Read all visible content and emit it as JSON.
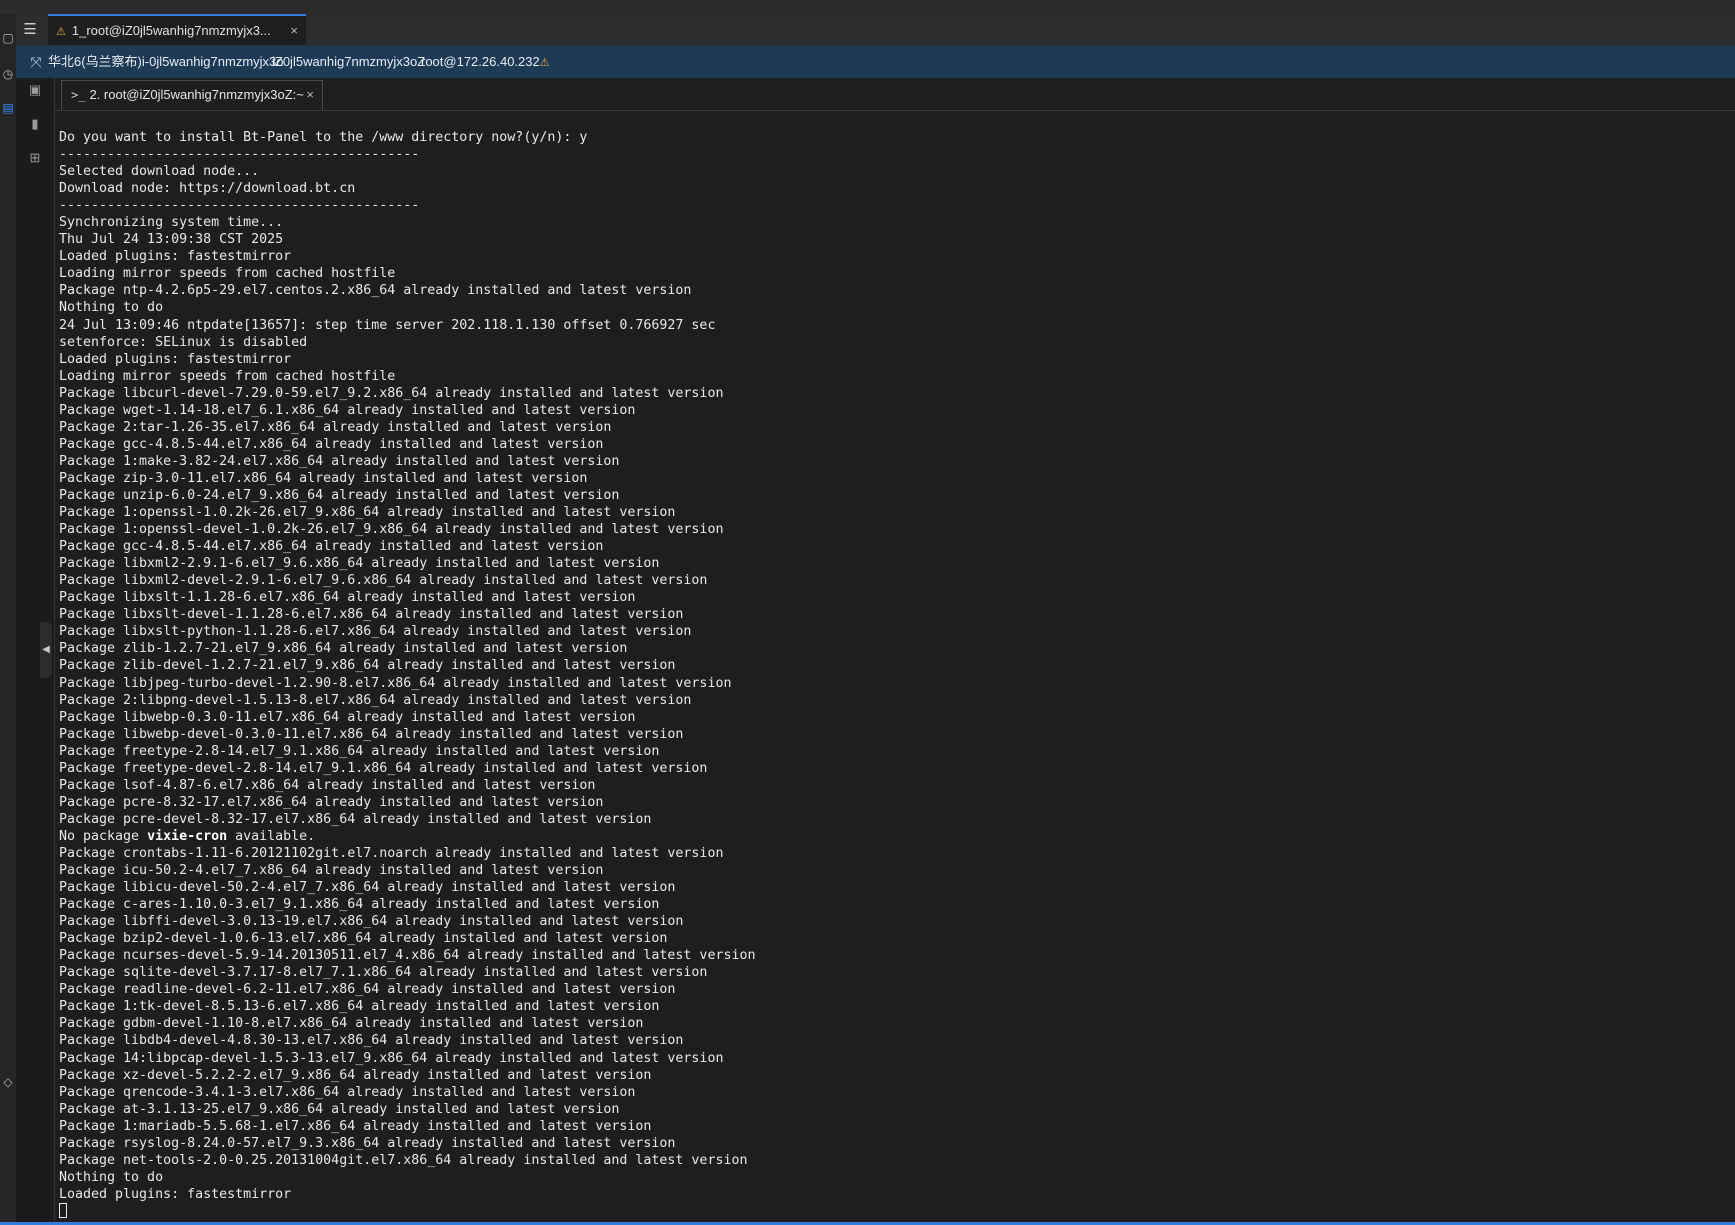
{
  "window": {
    "tab_title": "1_root@iZ0jl5wanhig7nmzmyjx3...",
    "tab_close": "×"
  },
  "session_bar": {
    "region_instance": "华北6(乌兰察布)i-0jl5wanhig7nmzmyjx3o",
    "hostname": "iZ0jl5wanhig7nmzmyjx3oZ",
    "user_ip": "root@172.26.40.232"
  },
  "terminal_tab": {
    "prompt_icon": ">_",
    "label": "2. root@iZ0jl5wanhig7nmzmyjx3oZ:~",
    "close": "×"
  },
  "colors": {
    "accent": "#2f7fd8",
    "session_bar_bg": "#1f3a55",
    "terminal_bg": "#1e1e1e",
    "terminal_fg": "#e8e8e8",
    "warning_icon": "#e8b04a"
  },
  "terminal": {
    "lines": [
      "Do you want to install Bt-Panel to the /www directory now?(y/n): y",
      "---------------------------------------------",
      "Selected download node...",
      "Download node: https://download.bt.cn",
      "---------------------------------------------",
      "Synchronizing system time...",
      "Thu Jul 24 13:09:38 CST 2025",
      "Loaded plugins: fastestmirror",
      "Loading mirror speeds from cached hostfile",
      "Package ntp-4.2.6p5-29.el7.centos.2.x86_64 already installed and latest version",
      "Nothing to do",
      "24 Jul 13:09:46 ntpdate[13657]: step time server 202.118.1.130 offset 0.766927 sec",
      "setenforce: SELinux is disabled",
      "Loaded plugins: fastestmirror",
      "Loading mirror speeds from cached hostfile",
      "Package libcurl-devel-7.29.0-59.el7_9.2.x86_64 already installed and latest version",
      "Package wget-1.14-18.el7_6.1.x86_64 already installed and latest version",
      "Package 2:tar-1.26-35.el7.x86_64 already installed and latest version",
      "Package gcc-4.8.5-44.el7.x86_64 already installed and latest version",
      "Package 1:make-3.82-24.el7.x86_64 already installed and latest version",
      "Package zip-3.0-11.el7.x86_64 already installed and latest version",
      "Package unzip-6.0-24.el7_9.x86_64 already installed and latest version",
      "Package 1:openssl-1.0.2k-26.el7_9.x86_64 already installed and latest version",
      "Package 1:openssl-devel-1.0.2k-26.el7_9.x86_64 already installed and latest version",
      "Package gcc-4.8.5-44.el7.x86_64 already installed and latest version",
      "Package libxml2-2.9.1-6.el7_9.6.x86_64 already installed and latest version",
      "Package libxml2-devel-2.9.1-6.el7_9.6.x86_64 already installed and latest version",
      "Package libxslt-1.1.28-6.el7.x86_64 already installed and latest version",
      "Package libxslt-devel-1.1.28-6.el7.x86_64 already installed and latest version",
      "Package libxslt-python-1.1.28-6.el7.x86_64 already installed and latest version",
      "Package zlib-1.2.7-21.el7_9.x86_64 already installed and latest version",
      "Package zlib-devel-1.2.7-21.el7_9.x86_64 already installed and latest version",
      "Package libjpeg-turbo-devel-1.2.90-8.el7.x86_64 already installed and latest version",
      "Package 2:libpng-devel-1.5.13-8.el7.x86_64 already installed and latest version",
      "Package libwebp-0.3.0-11.el7.x86_64 already installed and latest version",
      "Package libwebp-devel-0.3.0-11.el7.x86_64 already installed and latest version",
      "Package freetype-2.8-14.el7_9.1.x86_64 already installed and latest version",
      "Package freetype-devel-2.8-14.el7_9.1.x86_64 already installed and latest version",
      "Package lsof-4.87-6.el7.x86_64 already installed and latest version",
      "Package pcre-8.32-17.el7.x86_64 already installed and latest version",
      "Package pcre-devel-8.32-17.el7.x86_64 already installed and latest version",
      "No package vixie-cron available.",
      "Package crontabs-1.11-6.20121102git.el7.noarch already installed and latest version",
      "Package icu-50.2-4.el7_7.x86_64 already installed and latest version",
      "Package libicu-devel-50.2-4.el7_7.x86_64 already installed and latest version",
      "Package c-ares-1.10.0-3.el7_9.1.x86_64 already installed and latest version",
      "Package libffi-devel-3.0.13-19.el7.x86_64 already installed and latest version",
      "Package bzip2-devel-1.0.6-13.el7.x86_64 already installed and latest version",
      "Package ncurses-devel-5.9-14.20130511.el7_4.x86_64 already installed and latest version",
      "Package sqlite-devel-3.7.17-8.el7_7.1.x86_64 already installed and latest version",
      "Package readline-devel-6.2-11.el7.x86_64 already installed and latest version",
      "Package 1:tk-devel-8.5.13-6.el7.x86_64 already installed and latest version",
      "Package gdbm-devel-1.10-8.el7.x86_64 already installed and latest version",
      "Package libdb4-devel-4.8.30-13.el7.x86_64 already installed and latest version",
      "Package 14:libpcap-devel-1.5.3-13.el7_9.x86_64 already installed and latest version",
      "Package xz-devel-5.2.2-2.el7_9.x86_64 already installed and latest version",
      "Package qrencode-3.4.1-3.el7.x86_64 already installed and latest version",
      "Package at-3.1.13-25.el7_9.x86_64 already installed and latest version",
      "Package 1:mariadb-5.5.68-1.el7.x86_64 already installed and latest version",
      "Package rsyslog-8.24.0-57.el7_9.3.x86_64 already installed and latest version",
      "Package net-tools-2.0-0.25.20131004git.el7.x86_64 already installed and latest version",
      "Nothing to do",
      "Loaded plugins: fastestmirror"
    ]
  }
}
